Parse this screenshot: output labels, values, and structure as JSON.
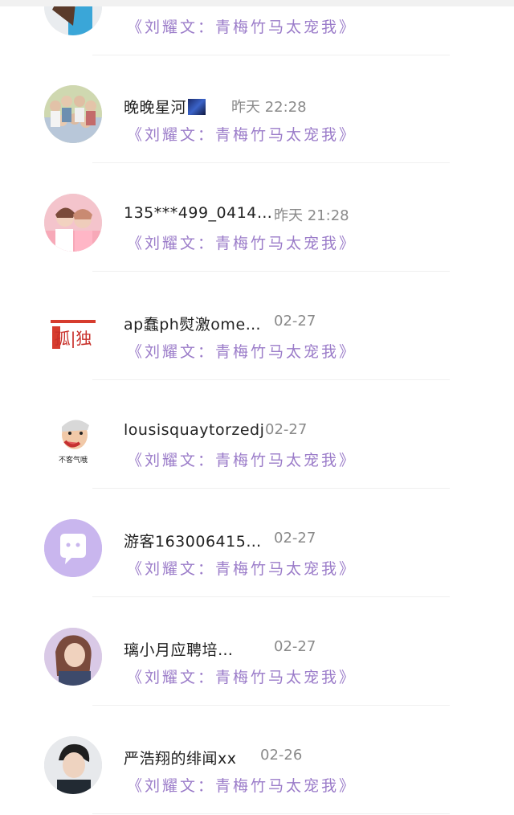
{
  "conversations": [
    {
      "name": "",
      "time": "",
      "message": "《刘耀文：青梅竹马太宠我》",
      "avatar": "person-blue-avatar"
    },
    {
      "name": "晚晚星河",
      "name_emoji": "galaxy-emoji",
      "time": "昨天 22:28",
      "message": "《刘耀文：青梅竹马太宠我》",
      "avatar": "group-photo-avatar"
    },
    {
      "name": "135***499_0414…",
      "time": "昨天 21:28",
      "message": "《刘耀文：青梅竹马太宠我》",
      "avatar": "pink-duo-avatar"
    },
    {
      "name": "ap蠢ph熨激ome…",
      "time": "02-27",
      "message": "《刘耀文：青梅竹马太宠我》",
      "avatar": "lonely-text-avatar",
      "avatar_text": "孤|独"
    },
    {
      "name": "lousisquaytorzedj",
      "time": "02-27",
      "message": "《刘耀文：青梅竹马太宠我》",
      "avatar": "cartoon-meme-avatar",
      "avatar_text": "不客气哦"
    },
    {
      "name": "游客163006415…",
      "time": "02-27",
      "message": "《刘耀文：青梅竹马太宠我》",
      "avatar": "default-chat-avatar"
    },
    {
      "name": "璃小月应聘培…",
      "time": "02-27",
      "message": "《刘耀文：青梅竹马太宠我》",
      "avatar": "illustrated-girl-avatar"
    },
    {
      "name": "严浩翔的绯闻xx",
      "time": "02-26",
      "message": "《刘耀文：青梅竹马太宠我》",
      "avatar": "boy-portrait-avatar"
    }
  ],
  "colors": {
    "message": "#9b7cc9",
    "name": "#222222",
    "time": "#8a8a8a",
    "default_avatar": "#c9b6ee"
  }
}
